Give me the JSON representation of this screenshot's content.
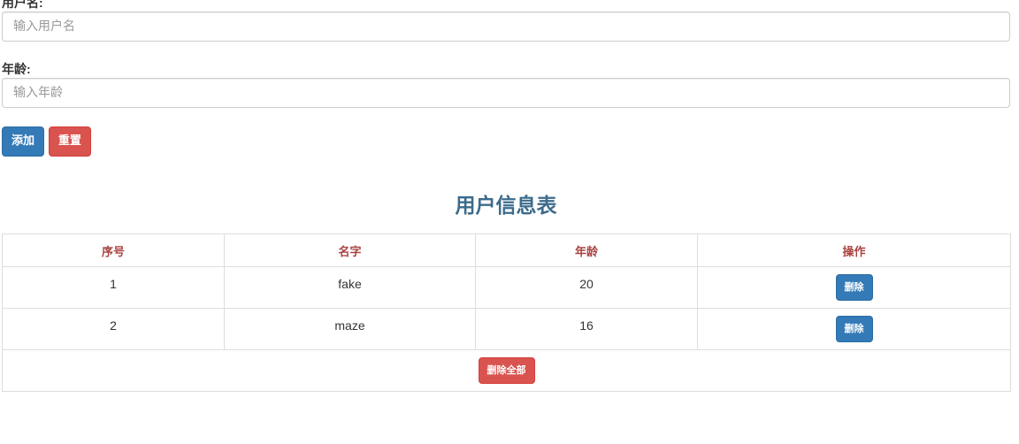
{
  "form": {
    "username_label": "用户名:",
    "username_placeholder": "输入用户名",
    "username_value": "",
    "age_label": "年龄:",
    "age_placeholder": "输入年龄",
    "age_value": "",
    "add_label": "添加",
    "reset_label": "重置"
  },
  "table": {
    "title": "用户信息表",
    "headers": [
      "序号",
      "名字",
      "年龄",
      "操作"
    ],
    "rows": [
      {
        "index": "1",
        "name": "fake",
        "age": "20",
        "action_label": "删除"
      },
      {
        "index": "2",
        "name": "maze",
        "age": "16",
        "action_label": "删除"
      }
    ],
    "delete_all_label": "删除全部"
  },
  "colors": {
    "primary": "#337ab7",
    "danger": "#d9534f",
    "header_text": "#a94442",
    "title_text": "#3c6b8c"
  }
}
